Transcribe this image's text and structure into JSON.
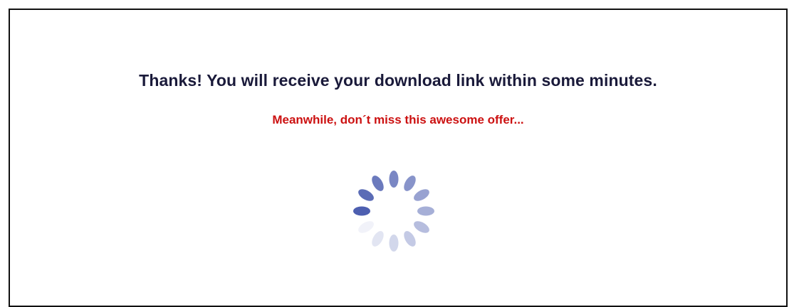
{
  "message": {
    "headline": "Thanks! You will receive your download link within some minutes.",
    "subline": "Meanwhile, don´t miss this awesome offer..."
  },
  "loading_indicator": {
    "icon": "loading-spinner-icon",
    "segments": 12
  },
  "colors": {
    "headline": "#1a1a3a",
    "subline": "#cc1111",
    "spinner": "#4d5fb0",
    "frame_border": "#111111",
    "background": "#ffffff"
  }
}
